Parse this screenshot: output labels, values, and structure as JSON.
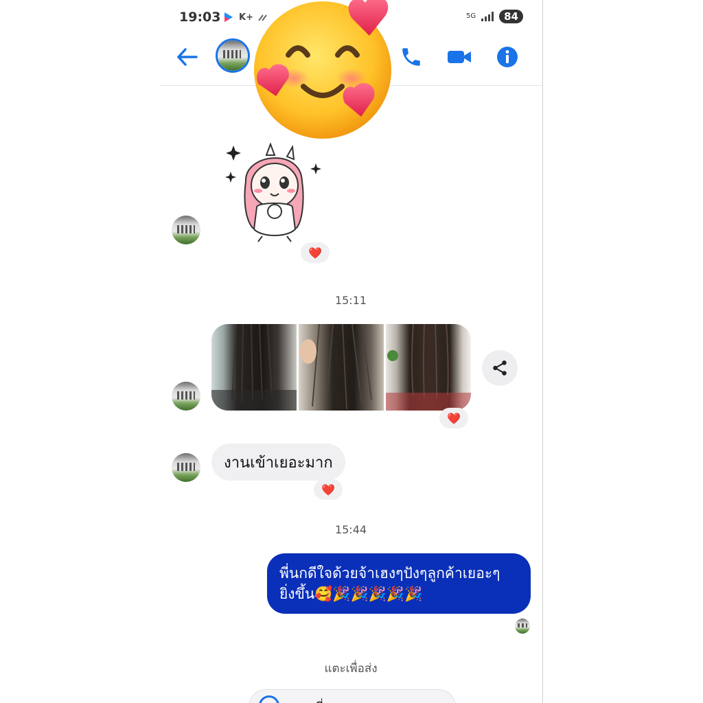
{
  "status_bar": {
    "time": "19:03",
    "app_icons": [
      "youku-icon",
      "k-plus-icon",
      "data-icon"
    ],
    "k_label": "K+",
    "network": "5G",
    "battery": "84"
  },
  "header": {
    "back_icon": "arrow-left-icon",
    "call_icon": "phone-icon",
    "video_icon": "video-camera-icon",
    "info_icon": "info-icon",
    "accent_color": "#1a73e8"
  },
  "messages": {
    "sticker": {
      "reaction": "❤️"
    },
    "timestamp_1": "15:11",
    "photos": {
      "reaction": "❤️",
      "share_icon": "share-icon"
    },
    "incoming_text": "งานเข้าเยอะมาก",
    "incoming_reaction": "❤️",
    "timestamp_2": "15:44",
    "outgoing_line1": "พี่นกดีใจด้วยจ้าเฮงๆปังๆลูกค้าเยอะๆ",
    "outgoing_line2": "ยิ่งขึ้น🥰🎉🎉🎉🎉🎉",
    "outgoing_color": "#0a2fb8"
  },
  "footer": {
    "tap_to_send": "แตะเพื่อส่ง",
    "pill_text": "พี่..."
  },
  "overlay": {
    "emoji": "smiling-face-with-hearts"
  }
}
